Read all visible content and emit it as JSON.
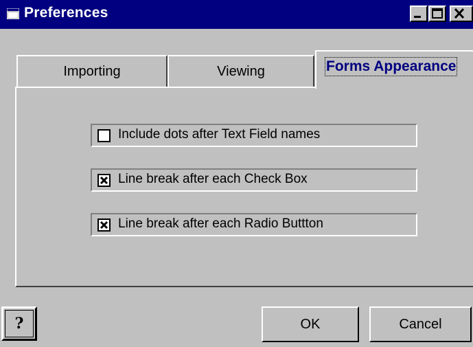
{
  "window": {
    "title": "Preferences",
    "title_icon": "window-icon",
    "controls": [
      "minimize-icon",
      "maximize-icon",
      "close-icon"
    ]
  },
  "tabs": [
    {
      "label": "Importing",
      "active": false
    },
    {
      "label": "Viewing",
      "active": false
    },
    {
      "label": "Forms Appearance",
      "active": true
    }
  ],
  "options": [
    {
      "label": "Include dots after Text Field names",
      "checked": false
    },
    {
      "label": "Line break after each Check Box",
      "checked": true
    },
    {
      "label": "Line break after each Radio Buttton",
      "checked": true
    }
  ],
  "buttons": {
    "help_icon": "help-icon",
    "ok": "OK",
    "cancel": "Cancel"
  },
  "colors": {
    "titlebar": "#000080",
    "face": "#c0c0c0",
    "active_tab_text": "#000080"
  }
}
